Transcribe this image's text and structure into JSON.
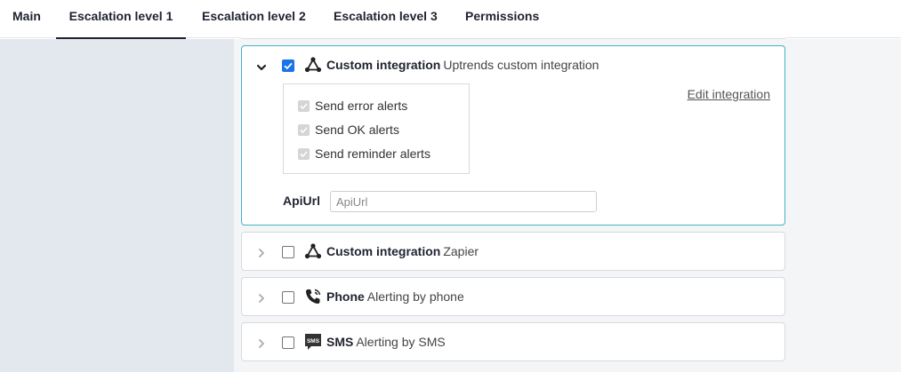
{
  "tabs": [
    {
      "label": "Main",
      "active": false
    },
    {
      "label": "Escalation level 1",
      "active": true
    },
    {
      "label": "Escalation level 2",
      "active": false
    },
    {
      "label": "Escalation level 3",
      "active": false
    },
    {
      "label": "Permissions",
      "active": false
    }
  ],
  "integrations": [
    {
      "name": "Custom integration",
      "description": "Uptrends custom integration",
      "icon": "integration-icon",
      "checked": true,
      "expanded": true,
      "alerts": [
        {
          "label": "Send error alerts",
          "checked": true
        },
        {
          "label": "Send OK alerts",
          "checked": true
        },
        {
          "label": "Send reminder alerts",
          "checked": true
        }
      ],
      "edit_link": "Edit integration",
      "field_label": "ApiUrl",
      "field_placeholder": "ApiUrl",
      "field_value": ""
    },
    {
      "name": "Custom integration",
      "description": "Zapier",
      "icon": "integration-icon",
      "checked": false,
      "expanded": false
    },
    {
      "name": "Phone",
      "description": "Alerting by phone",
      "icon": "phone-icon",
      "checked": false,
      "expanded": false
    },
    {
      "name": "SMS",
      "description": "Alerting by SMS",
      "icon": "sms-icon",
      "checked": false,
      "expanded": false,
      "icon_text": "SMS"
    }
  ],
  "colors": {
    "accent_border": "#40b4c2",
    "checkbox_checked": "#1a73e8",
    "sidebar_bg": "#e3e8ee"
  }
}
